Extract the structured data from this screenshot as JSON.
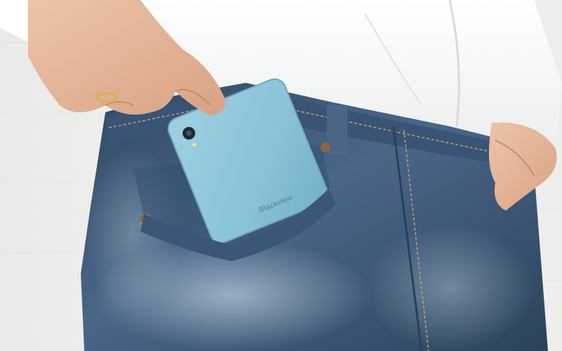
{
  "photo": {
    "phone": {
      "brand_text": "Blackview",
      "color": "#8ec4d8"
    },
    "colors": {
      "background": "#f2f2f1",
      "shirt": "#ffffff",
      "denim": "#3c5572",
      "denim_faded": "#8fa5bd",
      "skin": "#e2b296",
      "stitching": "#c7a06a"
    }
  }
}
